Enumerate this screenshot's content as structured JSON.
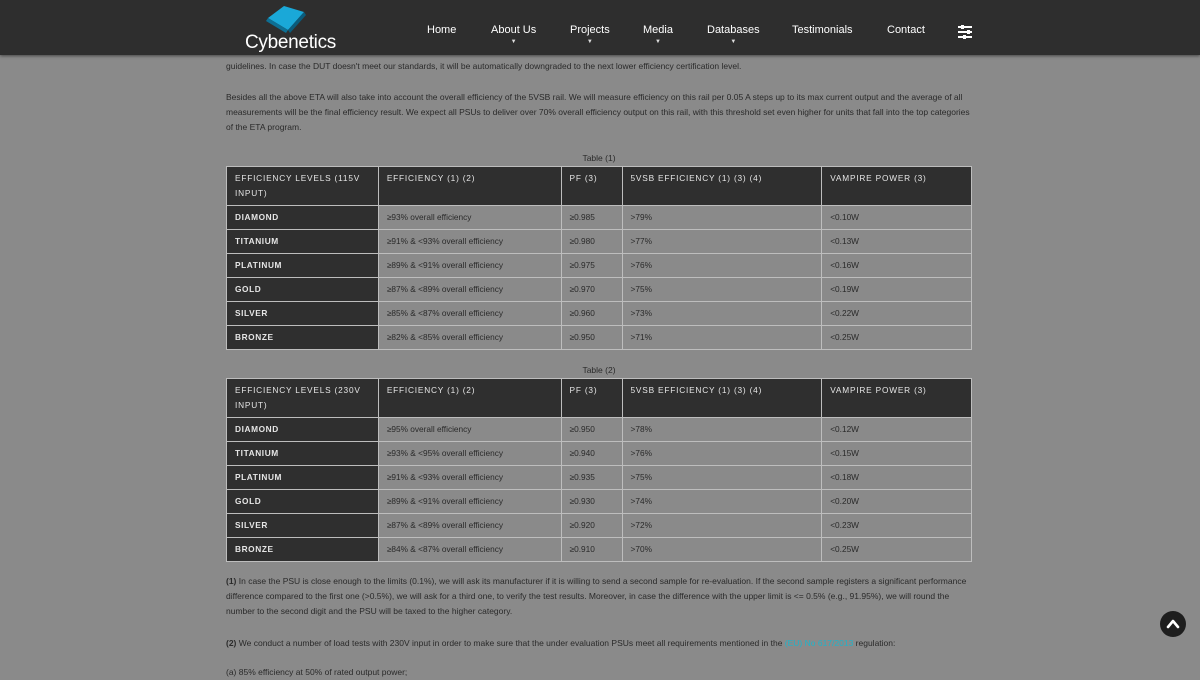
{
  "header": {
    "logo_text": "Cybenetics",
    "nav": [
      {
        "label": "Home"
      },
      {
        "label": "About Us"
      },
      {
        "label": "Projects"
      },
      {
        "label": "Media"
      },
      {
        "label": "Databases"
      },
      {
        "label": "Testimonials"
      },
      {
        "label": "Contact"
      }
    ]
  },
  "content": {
    "para_top": "guidelines. In case the DUT doesn't meet our standards, it will be automatically downgraded to the next lower efficiency certification level.",
    "para_5vsb": "Besides all the above ETA will also take into account the overall efficiency of the 5VSB rail. We will measure efficiency on this rail per 0.05 A steps up to its max current output and the average of all measurements will be the final efficiency result. We expect all PSUs to deliver over 70% overall efficiency output on this rail, with this threshold set even higher for units that fall into the top categories of the ETA program.",
    "table1": {
      "caption": "Table (1)",
      "headers": [
        "EFFICIENCY LEVELS (115V INPUT)",
        "EFFICIENCY (1) (2)",
        "PF (3)",
        "5VSB EFFICIENCY (1) (3) (4)",
        "VAMPIRE POWER (3)"
      ],
      "rows": [
        [
          "DIAMOND",
          "≥93% overall efficiency",
          "≥0.985",
          ">79%",
          "<0.10W"
        ],
        [
          "TITANIUM",
          "≥91% & <93% overall efficiency",
          "≥0.980",
          ">77%",
          "<0.13W"
        ],
        [
          "PLATINUM",
          "≥89% & <91% overall efficiency",
          "≥0.975",
          ">76%",
          "<0.16W"
        ],
        [
          "GOLD",
          "≥87% & <89% overall efficiency",
          "≥0.970",
          ">75%",
          "<0.19W"
        ],
        [
          "SILVER",
          "≥85% & <87% overall efficiency",
          "≥0.960",
          ">73%",
          "<0.22W"
        ],
        [
          "BRONZE",
          "≥82% & <85% overall efficiency",
          "≥0.950",
          ">71%",
          "<0.25W"
        ]
      ]
    },
    "table2": {
      "caption": "Table (2)",
      "headers": [
        "EFFICIENCY LEVELS (230V INPUT)",
        "EFFICIENCY (1) (2)",
        "PF (3)",
        "5VSB EFFICIENCY (1) (3) (4)",
        "VAMPIRE POWER (3)"
      ],
      "rows": [
        [
          "DIAMOND",
          "≥95% overall efficiency",
          "≥0.950",
          ">78%",
          "<0.12W"
        ],
        [
          "TITANIUM",
          "≥93% & <95% overall efficiency",
          "≥0.940",
          ">76%",
          "<0.15W"
        ],
        [
          "PLATINUM",
          "≥91% & <93% overall efficiency",
          "≥0.935",
          ">75%",
          "<0.18W"
        ],
        [
          "GOLD",
          "≥89% & <91% overall efficiency",
          "≥0.930",
          ">74%",
          "<0.20W"
        ],
        [
          "SILVER",
          "≥87% & <89% overall efficiency",
          "≥0.920",
          ">72%",
          "<0.23W"
        ],
        [
          "BRONZE",
          "≥84% & <87% overall efficiency",
          "≥0.910",
          ">70%",
          "<0.25W"
        ]
      ]
    },
    "note1_num": "(1)",
    "note1_text": " In case the PSU is close enough to the limits (0.1%), we will ask its manufacturer if it is willing to send a second sample for re-evaluation. If the second sample registers a significant performance difference compared to the first one (>0.5%), we will ask for a third one, to verify the test results. Moreover, in case the difference with the upper limit is <= 0.5% (e.g., 91.95%), we will round the number to the second digit and the PSU will be taxed to the higher category.",
    "note2_num": "(2)",
    "note2_text": " We conduct a number of load tests with 230V input in order to make sure that the under evaluation PSUs meet all requirements mentioned in the ",
    "note2_link": "(EU) No 617/2013",
    "note2_tail": " regulation:",
    "note2_item": "(a) 85% efficiency at 50% of rated output power;"
  }
}
